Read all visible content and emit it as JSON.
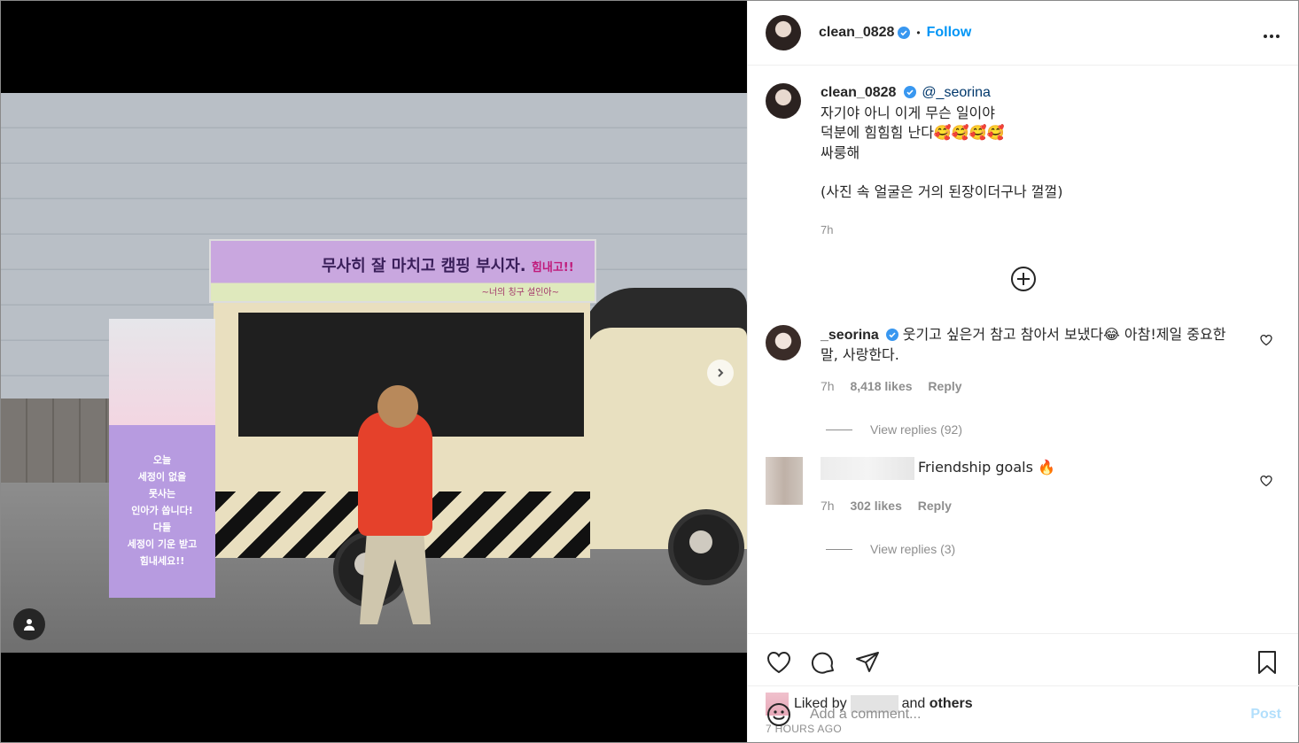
{
  "post": {
    "username": "clean_0828",
    "follow_label": "Follow",
    "more_icon": "more-options-icon",
    "photo": {
      "banner_text": "무사히 잘 마치고 캠핑 부시자.",
      "banner_tag": "힘내고!!",
      "banner_sub": "~너의 칭구 설인아~",
      "standee_lines": [
        "오늘",
        "세정이 없을",
        "못사는",
        "인아가 쏩니다!",
        "다들",
        "세정이 기운 받고",
        "힘내세요!!"
      ]
    },
    "caption": {
      "mention": "@_seorina",
      "lines": [
        "자기야 아니 이게 무슨 일이야",
        "덕분에 힘힘힘 난다🥰🥰🥰🥰",
        "싸룽해",
        "",
        "(사진 속 얼굴은 거의 된장이더구나 껄껄)"
      ],
      "time": "7h"
    },
    "comments": [
      {
        "username": "_seorina",
        "text": "웃기고 싶은거 참고 참아서 보냈다😂 아참!제일 중요한 말, 사랑한다.",
        "time": "7h",
        "likes": "8,418 likes",
        "reply": "Reply",
        "view_replies": "View replies (92)"
      },
      {
        "username": "",
        "text": "Friendship goals 🔥",
        "time": "7h",
        "likes": "302 likes",
        "reply": "Reply",
        "view_replies": "View replies (3)"
      }
    ],
    "liked_by_prefix": "Liked by",
    "liked_by_suffix": "and",
    "liked_by_others": "others",
    "time_ago": "7 HOURS AGO",
    "comment_placeholder": "Add a comment...",
    "post_label": "Post"
  },
  "colors": {
    "link": "#0095f6",
    "muted": "#8e8e8e",
    "post_disabled": "#b2dffc",
    "text": "#262626"
  }
}
